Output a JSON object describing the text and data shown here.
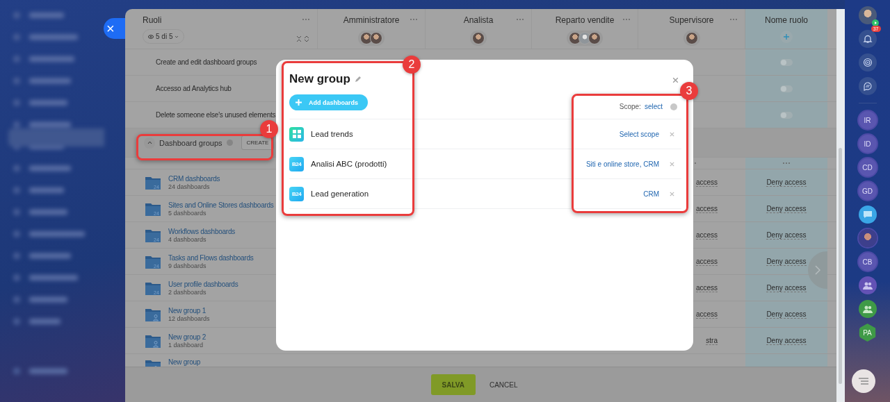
{
  "side_close": {
    "label": "×"
  },
  "table": {
    "title": "Ruoli",
    "filter_chip": "5 di 5",
    "columns": [
      {
        "title": "Amministratore",
        "avatars": [
          {
            "kind": "photo"
          },
          {
            "kind": "photo"
          }
        ]
      },
      {
        "title": "Analista",
        "avatars": [
          {
            "kind": "photo"
          }
        ]
      },
      {
        "title": "Reparto vendite",
        "avatars": [
          {
            "kind": "photo"
          },
          {
            "kind": "placeholder"
          },
          {
            "kind": "photo"
          }
        ]
      },
      {
        "title": "Supervisore",
        "avatars": [
          {
            "kind": "photo"
          }
        ]
      },
      {
        "title": "Nome ruolo",
        "kind": "new"
      }
    ],
    "permissions": [
      {
        "label": "Create and edit dashboard groups",
        "on": false
      },
      {
        "label": "Accesso ad Analytics hub",
        "on": false
      },
      {
        "label": "Delete someone else's unused elements",
        "on": false
      }
    ],
    "section": {
      "title": "Dashboard groups",
      "expanded": true,
      "button": "CREATE"
    },
    "groups": [
      {
        "name": "CRM dashboards",
        "count": "24 dashboards",
        "kind": "b24",
        "folder_badge": "24",
        "supervisor": "access",
        "role": "Deny access"
      },
      {
        "name": "Sites and Online Stores dashboards",
        "count": "5 dashboards",
        "kind": "b24",
        "folder_badge": "24",
        "supervisor": "access",
        "role": "Deny access"
      },
      {
        "name": "Workflows dashboards",
        "count": "4 dashboards",
        "kind": "b24",
        "folder_badge": "24",
        "supervisor": "access",
        "role": "Deny access"
      },
      {
        "name": "Tasks and Flows dashboards",
        "count": "9 dashboards",
        "kind": "b24",
        "folder_badge": "24",
        "supervisor": "access",
        "role": "Deny access"
      },
      {
        "name": "User profile dashboards",
        "count": "2 dashboards",
        "kind": "b24",
        "folder_badge": "24",
        "supervisor": "access",
        "role": "Deny access"
      },
      {
        "name": "New group 1",
        "count": "12 dashboards",
        "kind": "person",
        "supervisor": "access",
        "role": "Deny access"
      },
      {
        "name": "New group 2",
        "count": "1 dashboard",
        "kind": "person",
        "supervisor": "stra",
        "role": "Deny access"
      },
      {
        "name": "New group",
        "kind": "person"
      }
    ]
  },
  "footer": {
    "buttons": [
      {
        "label": "SALVA",
        "kind": "primary"
      },
      {
        "label": "CANCEL",
        "kind": "text"
      }
    ]
  },
  "modal": {
    "title": "New group",
    "add_button": "Add dashboards",
    "scope_label": "Scope:",
    "scope_link": "select",
    "items": [
      {
        "name": "Lead trends",
        "kind": "grid",
        "scope": "Select scope"
      },
      {
        "name": "Analisi ABC (prodotti)",
        "kind": "b24",
        "icon_text": "B24",
        "scope": "Siti e online store, CRM"
      },
      {
        "name": "Lead generation",
        "kind": "b24",
        "icon_text": "B24",
        "scope": "CRM"
      }
    ]
  },
  "callouts": [
    {
      "label": "1"
    },
    {
      "label": "2"
    },
    {
      "label": "3"
    }
  ],
  "right_bar": {
    "items": [
      {
        "kind": "user"
      },
      {
        "kind": "bell",
        "badge": "37"
      },
      {
        "kind": "target"
      },
      {
        "kind": "swap"
      },
      {
        "kind": "divider"
      },
      {
        "kind": "initials",
        "text": "IR"
      },
      {
        "kind": "initials",
        "text": "ID"
      },
      {
        "kind": "initials",
        "text": "CD"
      },
      {
        "kind": "initials",
        "text": "GD"
      },
      {
        "kind": "chat"
      },
      {
        "kind": "photo"
      },
      {
        "kind": "initials",
        "text": "CB"
      },
      {
        "kind": "group"
      },
      {
        "kind": "group-green"
      },
      {
        "kind": "hex",
        "text": "PA"
      }
    ]
  }
}
